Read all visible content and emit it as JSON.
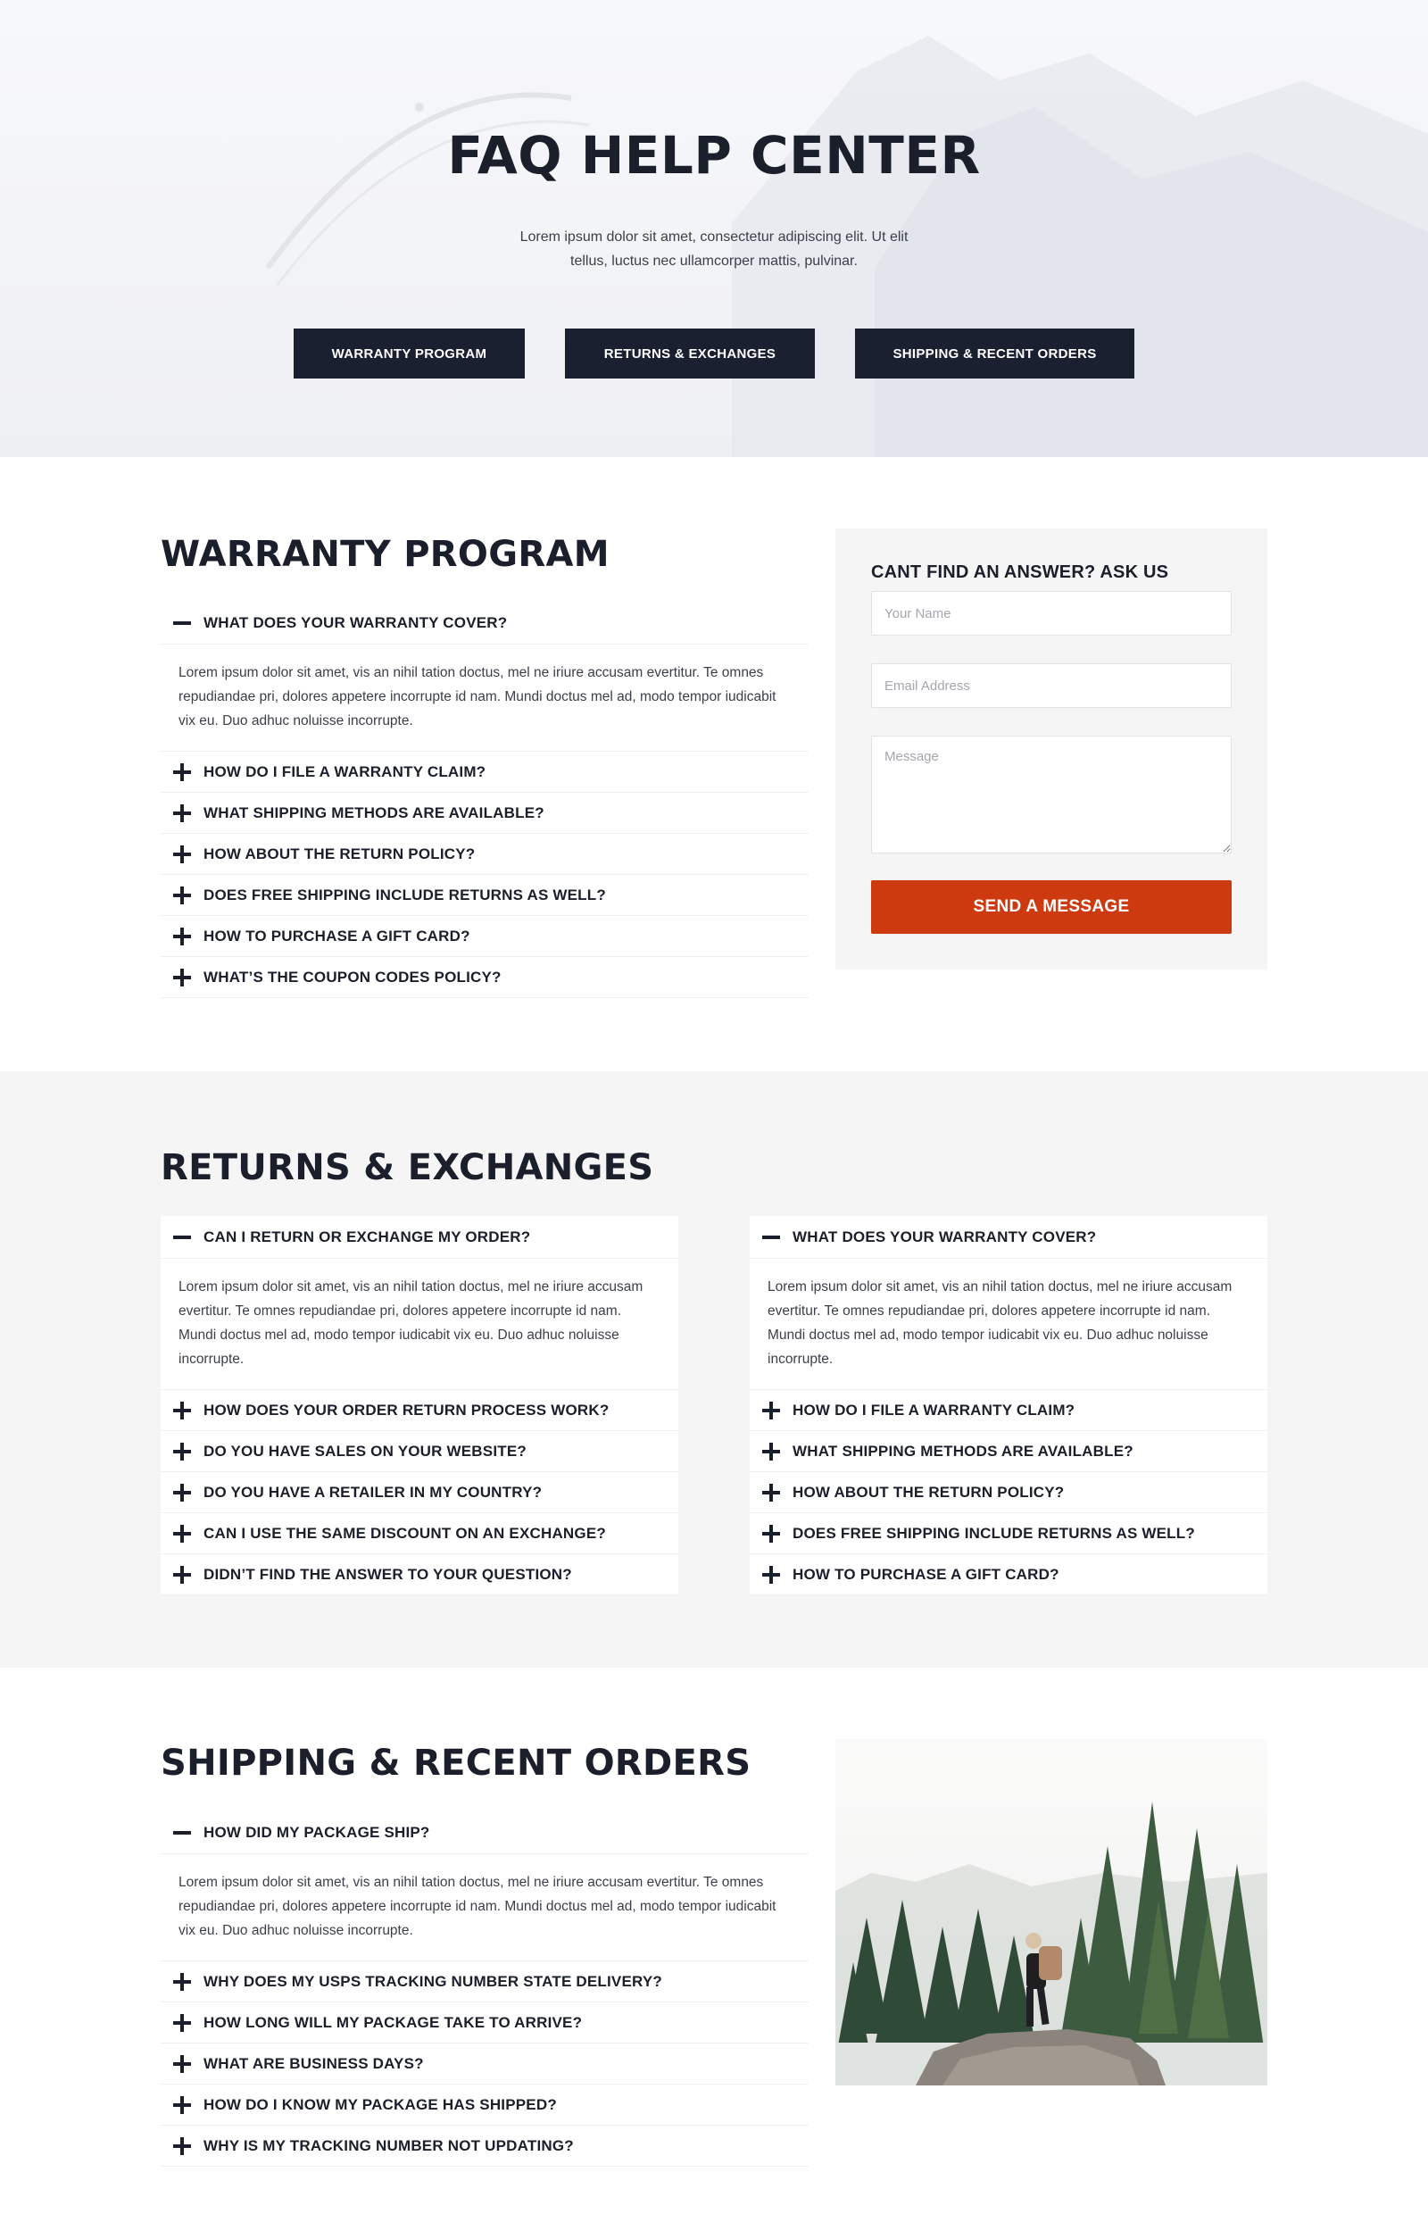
{
  "hero": {
    "title": "FAQ HELP CENTER",
    "subtitle": "Lorem ipsum dolor sit amet, consectetur adipiscing elit. Ut elit tellus, luctus nec ullamcorper mattis, pulvinar.",
    "buttons": [
      "WARRANTY PROGRAM",
      "RETURNS & EXCHANGES",
      "SHIPPING & RECENT ORDERS"
    ]
  },
  "warranty": {
    "title": "WARRANTY PROGRAM",
    "open_question": "WHAT DOES YOUR WARRANTY COVER?",
    "open_answer": "Lorem ipsum dolor sit amet, vis an nihil tation doctus, mel ne iriure accusam evertitur. Te omnes repudiandae pri, dolores appetere incorrupte id nam. Mundi doctus mel ad, modo tempor iudicabit vix eu. Duo adhuc noluisse incorrupte.",
    "questions": [
      "HOW DO I FILE A WARRANTY CLAIM?",
      "WHAT SHIPPING METHODS ARE AVAILABLE?",
      "HOW ABOUT THE RETURN POLICY?",
      "DOES FREE SHIPPING INCLUDE RETURNS AS WELL?",
      "HOW TO PURCHASE A GIFT CARD?",
      "WHAT’S THE COUPON CODES POLICY?"
    ]
  },
  "contact_form": {
    "title": "CANT FIND AN ANSWER? ASK US",
    "name_placeholder": "Your Name",
    "email_placeholder": "Email Address",
    "message_placeholder": "Message",
    "submit_label": "SEND A MESSAGE",
    "accent_color": "#cd3a10"
  },
  "returns": {
    "title": "RETURNS & EXCHANGES",
    "left": {
      "open_question": "CAN I RETURN OR EXCHANGE MY ORDER?",
      "open_answer": "Lorem ipsum dolor sit amet, vis an nihil tation doctus, mel ne iriure accusam evertitur. Te omnes repudiandae pri, dolores appetere incorrupte id nam. Mundi doctus mel ad, modo tempor iudicabit vix eu. Duo adhuc noluisse incorrupte.",
      "questions": [
        "HOW DOES YOUR ORDER RETURN PROCESS WORK?",
        "DO YOU HAVE SALES ON YOUR WEBSITE?",
        "DO YOU HAVE A RETAILER IN MY COUNTRY?",
        "CAN I USE THE SAME DISCOUNT ON AN EXCHANGE?",
        "DIDN’T FIND THE ANSWER TO YOUR QUESTION?"
      ]
    },
    "right": {
      "open_question": "WHAT DOES YOUR WARRANTY COVER?",
      "open_answer": "Lorem ipsum dolor sit amet, vis an nihil tation doctus, mel ne iriure accusam evertitur. Te omnes repudiandae pri, dolores appetere incorrupte id nam. Mundi doctus mel ad, modo tempor iudicabit vix eu. Duo adhuc noluisse incorrupte.",
      "questions": [
        "HOW DO I FILE A WARRANTY CLAIM?",
        "WHAT SHIPPING METHODS ARE AVAILABLE?",
        "HOW ABOUT THE RETURN POLICY?",
        "DOES FREE SHIPPING INCLUDE RETURNS AS WELL?",
        "HOW TO PURCHASE A GIFT CARD?"
      ]
    }
  },
  "shipping": {
    "title": "SHIPPING & RECENT ORDERS",
    "open_question": "HOW DID MY PACKAGE SHIP?",
    "open_answer": "Lorem ipsum dolor sit amet, vis an nihil tation doctus, mel ne iriure accusam evertitur. Te omnes repudiandae pri, dolores appetere incorrupte id nam. Mundi doctus mel ad, modo tempor iudicabit vix eu. Duo adhuc noluisse incorrupte.",
    "questions": [
      "WHY DOES MY USPS TRACKING NUMBER STATE DELIVERY?",
      "HOW LONG WILL MY PACKAGE TAKE TO ARRIVE?",
      "WHAT ARE BUSINESS DAYS?",
      "HOW DO I KNOW MY PACKAGE HAS SHIPPED?",
      "WHY IS MY TRACKING NUMBER NOT UPDATING?"
    ]
  }
}
